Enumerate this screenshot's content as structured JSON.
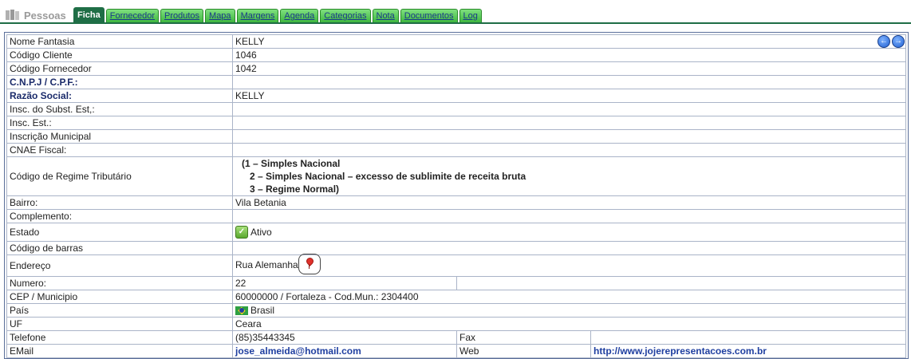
{
  "header": {
    "app_title": "Pessoas",
    "tabs": [
      {
        "label": "Ficha",
        "active": true
      },
      {
        "label": "Fornecedor"
      },
      {
        "label": "Produtos"
      },
      {
        "label": "Mapa"
      },
      {
        "label": "Margens"
      },
      {
        "label": "Agenda"
      },
      {
        "label": "Categorias"
      },
      {
        "label": "Nota"
      },
      {
        "label": "Documentos"
      },
      {
        "label": "Log"
      }
    ]
  },
  "nav": {
    "prev_icon": "arrow-left-circle-icon",
    "next_icon": "arrow-right-circle-icon"
  },
  "fields": {
    "nome_fantasia": {
      "label": "Nome Fantasia",
      "value": "KELLY"
    },
    "codigo_cliente": {
      "label": "Código Cliente",
      "value": "1046"
    },
    "codigo_fornecedor": {
      "label": "Código Fornecedor",
      "value": "1042"
    },
    "cnpj": {
      "label": "C.N.P.J / C.P.F.:",
      "value": ""
    },
    "razao_social": {
      "label": "Razão Social:",
      "value": "KELLY"
    },
    "insc_subst": {
      "label": "Insc. do Subst. Est,:",
      "value": ""
    },
    "insc_est": {
      "label": "Insc. Est.:",
      "value": ""
    },
    "insc_municipal": {
      "label": "Inscrição Municipal",
      "value": ""
    },
    "cnae": {
      "label": "CNAE Fiscal:",
      "value": ""
    },
    "regime": {
      "label": "Código de Regime Tributário",
      "line1": "(1 – Simples Nacional",
      "line2": "2 – Simples Nacional – excesso de sublimite de receita bruta",
      "line3": "3 – Regime Normal)"
    },
    "bairro": {
      "label": "Bairro:",
      "value": "Vila Betania"
    },
    "complemento": {
      "label": "Complemento:",
      "value": ""
    },
    "estado": {
      "label": "Estado",
      "value": "Ativo",
      "color": "#5aa82e"
    },
    "codigo_barras": {
      "label": "Código de barras",
      "value": ""
    },
    "endereco": {
      "label": "Endereço",
      "value": "Rua Alemanha"
    },
    "numero": {
      "label": "Numero:",
      "value": "22"
    },
    "cep": {
      "label": "CEP / Municipio",
      "value": "60000000 / Fortaleza - Cod.Mun.: 2304400"
    },
    "pais": {
      "label": "País",
      "value": "Brasil"
    },
    "uf": {
      "label": "UF",
      "value": "Ceara"
    },
    "telefone": {
      "label": "Telefone",
      "value": "(85)35443345"
    },
    "fax": {
      "label": "Fax",
      "value": ""
    },
    "email": {
      "label": "EMail",
      "value": "jose_almeida@hotmail.com"
    },
    "web": {
      "label": "Web",
      "value": "http://www.jojerepresentacoes.com.br"
    }
  },
  "colors": {
    "tab_active": "#1f6e46",
    "tab_bg": "#3fb73f",
    "link": "#1f3fa0"
  }
}
